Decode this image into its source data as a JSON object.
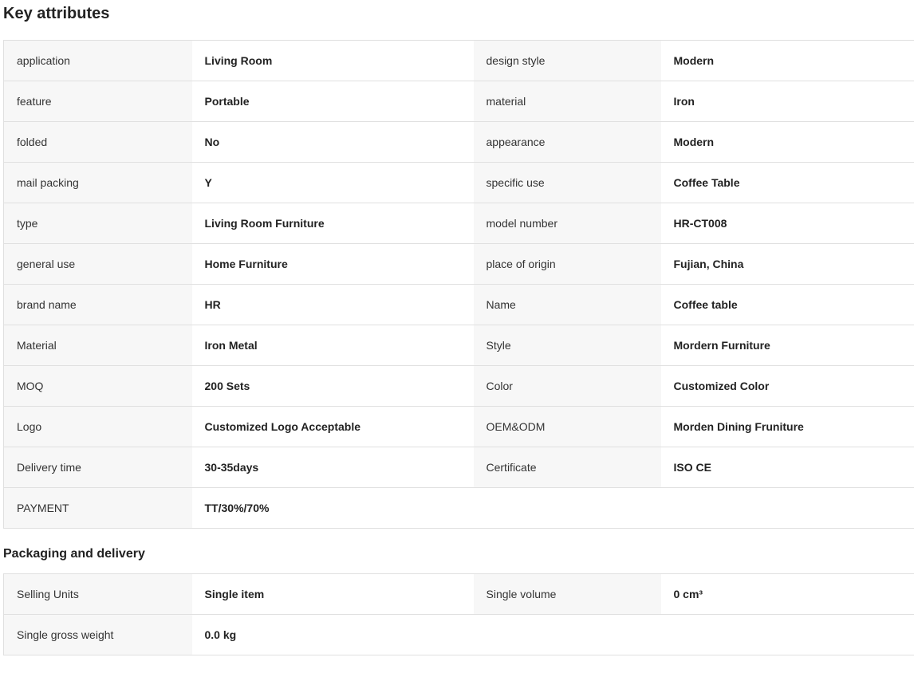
{
  "key_attributes": {
    "title": "Key attributes",
    "rows": [
      [
        [
          "application",
          "Living Room"
        ],
        [
          "design style",
          "Modern"
        ]
      ],
      [
        [
          "feature",
          "Portable"
        ],
        [
          "material",
          "Iron"
        ]
      ],
      [
        [
          "folded",
          "No"
        ],
        [
          "appearance",
          "Modern"
        ]
      ],
      [
        [
          "mail packing",
          "Y"
        ],
        [
          "specific use",
          "Coffee Table"
        ]
      ],
      [
        [
          "type",
          "Living Room Furniture"
        ],
        [
          "model number",
          "HR-CT008"
        ]
      ],
      [
        [
          "general use",
          "Home Furniture"
        ],
        [
          "place of origin",
          "Fujian, China"
        ]
      ],
      [
        [
          "brand name",
          "HR"
        ],
        [
          "Name",
          "Coffee table"
        ]
      ],
      [
        [
          "Material",
          "Iron Metal"
        ],
        [
          "Style",
          "Mordern Furniture"
        ]
      ],
      [
        [
          "MOQ",
          "200 Sets"
        ],
        [
          "Color",
          "Customized Color"
        ]
      ],
      [
        [
          "Logo",
          "Customized Logo Acceptable"
        ],
        [
          "OEM&ODM",
          "Morden Dining Fruniture"
        ]
      ],
      [
        [
          "Delivery time",
          "30-35days"
        ],
        [
          "Certificate",
          "ISO CE"
        ]
      ],
      [
        [
          "PAYMENT",
          "TT/30%/70%"
        ],
        [
          "",
          ""
        ]
      ]
    ]
  },
  "packaging": {
    "title": "Packaging and delivery",
    "rows": [
      [
        [
          "Selling Units",
          "Single item"
        ],
        [
          "Single volume",
          "0 cm³"
        ]
      ],
      [
        [
          "Single gross weight",
          "0.0 kg"
        ],
        [
          "",
          ""
        ]
      ]
    ]
  }
}
